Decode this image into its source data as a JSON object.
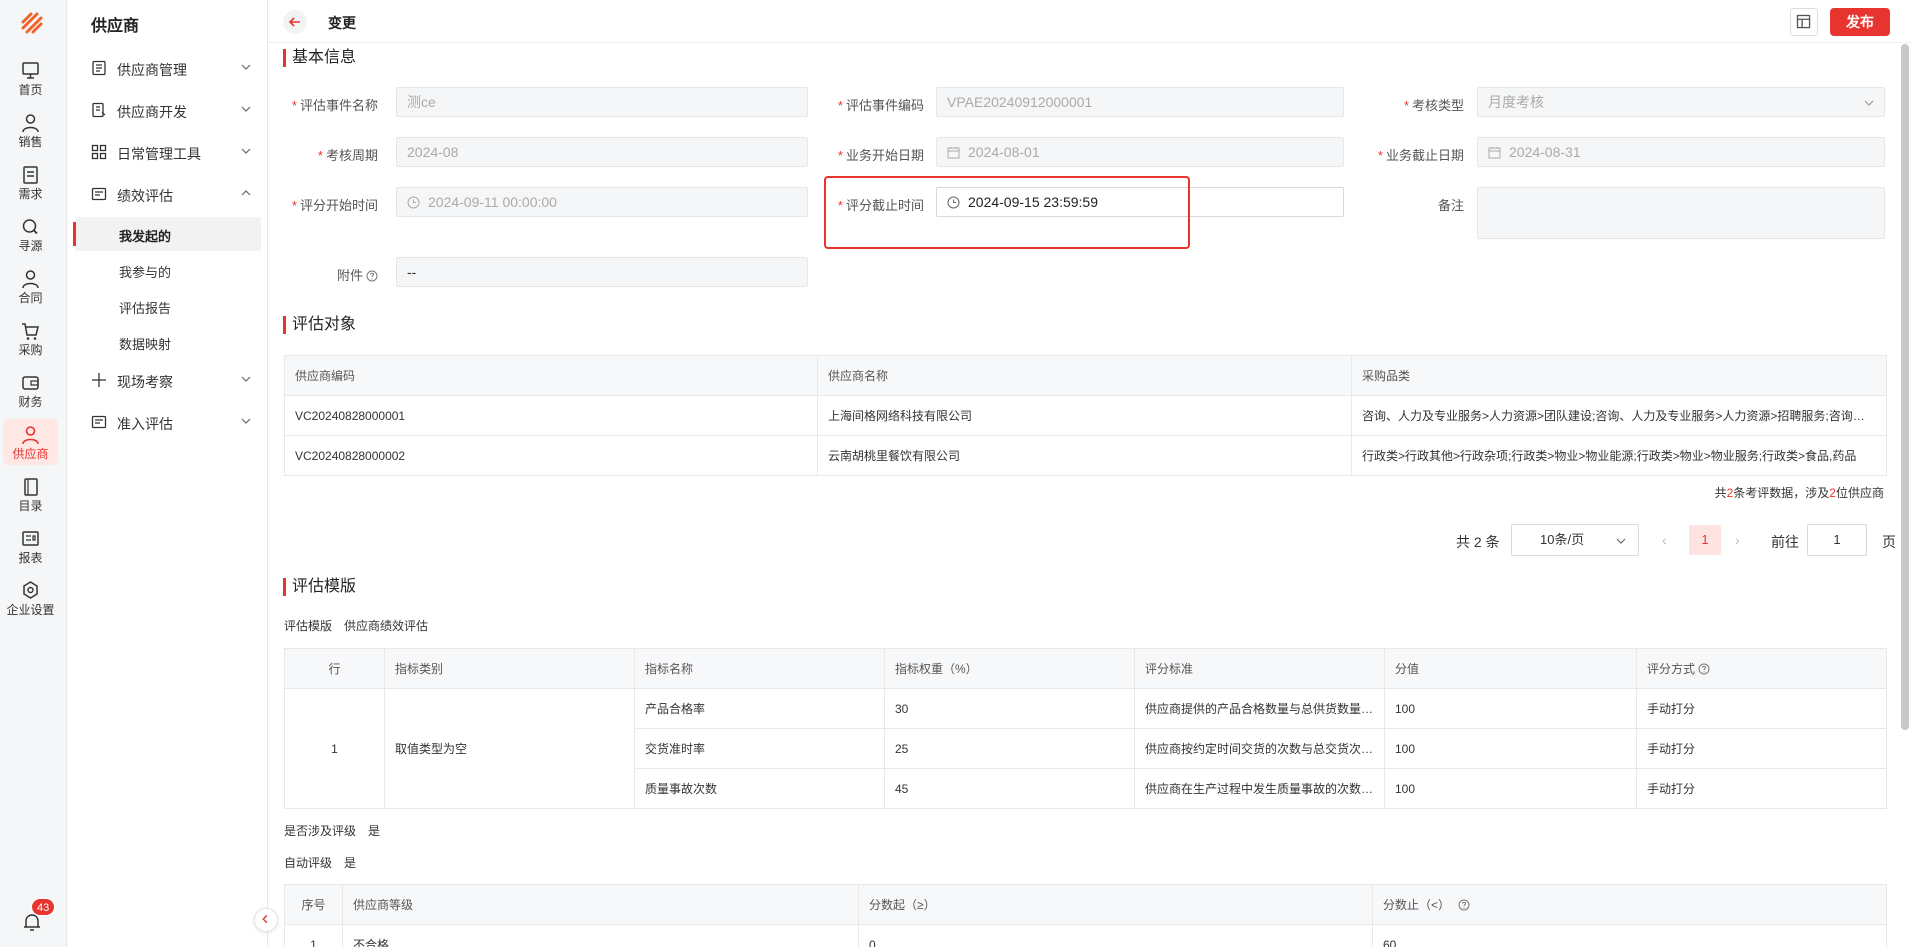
{
  "rail": {
    "items": [
      {
        "label": "首页",
        "icon": "monitor-icon"
      },
      {
        "label": "销售",
        "icon": "person-icon"
      },
      {
        "label": "需求",
        "icon": "clipboard-icon"
      },
      {
        "label": "寻源",
        "icon": "search-icon"
      },
      {
        "label": "合同",
        "icon": "person-icon"
      },
      {
        "label": "采购",
        "icon": "cart-icon"
      },
      {
        "label": "财务",
        "icon": "wallet-icon"
      },
      {
        "label": "供应商",
        "icon": "person-icon"
      },
      {
        "label": "目录",
        "icon": "book-icon"
      },
      {
        "label": "报表",
        "icon": "report-icon"
      },
      {
        "label": "企业设置",
        "icon": "hexagon-settings-icon"
      }
    ],
    "notification_count": "43"
  },
  "menu": {
    "title": "供应商",
    "items": [
      {
        "label": "供应商管理"
      },
      {
        "label": "供应商开发"
      },
      {
        "label": "日常管理工具"
      },
      {
        "label": "绩效评估"
      },
      {
        "label": "现场考察"
      },
      {
        "label": "准入评估"
      }
    ],
    "sub_items": [
      {
        "label": "我发起的"
      },
      {
        "label": "我参与的"
      },
      {
        "label": "评估报告"
      },
      {
        "label": "数据映射"
      }
    ]
  },
  "topbar": {
    "title": "变更",
    "publish_label": "发布"
  },
  "basic": {
    "section_title": "基本信息",
    "event_name_label": "评估事件名称",
    "event_name_value": "测ce",
    "event_code_label": "评估事件编码",
    "event_code_value": "VPAE20240912000001",
    "type_label": "考核类型",
    "type_value": "月度考核",
    "period_label": "考核周期",
    "period_value": "2024-08",
    "biz_start_label": "业务开始日期",
    "biz_start_value": "2024-08-01",
    "biz_end_label": "业务截止日期",
    "biz_end_value": "2024-08-31",
    "score_start_label": "评分开始时间",
    "score_start_value": "2024-09-11 00:00:00",
    "score_end_label": "评分截止时间",
    "score_end_value": "2024-09-15 23:59:59",
    "remark_label": "备注",
    "attach_label": "附件",
    "attach_value": "--",
    "required_mark": "*"
  },
  "objects": {
    "section_title": "评估对象",
    "headers": [
      "供应商编码",
      "供应商名称",
      "采购品类"
    ],
    "rows": [
      [
        "VC20240828000001",
        "上海间格网络科技有限公司",
        "咨询、人力及专业服务>人力资源>团队建设;咨询、人力及专业服务>人力资源>招聘服务;咨询、人力及专业服务"
      ],
      [
        "VC20240828000002",
        "云南胡桃里餐饮有限公司",
        "行政类>行政其他>行政杂项;行政类>物业>物业能源;行政类>物业>物业服务;行政类>食品,药品"
      ]
    ],
    "summary_pre": "共",
    "summary_count": "2",
    "summary_mid": "条考评数据，涉及",
    "summary_suppliers": "2",
    "summary_post": "位供应商"
  },
  "pager": {
    "total": "共 2 条",
    "page_size": "10条/页",
    "prev": "‹",
    "current": "1",
    "next": "›",
    "goto_label": "前往",
    "goto_value": "1",
    "page_suffix": "页"
  },
  "template": {
    "section_title": "评估模版",
    "template_label": "评估模版",
    "template_value": "供应商绩效评估",
    "headers": [
      "行",
      "指标类别",
      "指标名称",
      "指标权重（%）",
      "评分标准",
      "分值",
      "评分方式"
    ],
    "row_no": "1",
    "category": "取值类型为空",
    "rows": [
      {
        "name": "产品合格率",
        "weight": "30",
        "standard": "供应商提供的产品合格数量与总供货数量的比率",
        "score": "100",
        "method": "手动打分"
      },
      {
        "name": "交货准时率",
        "weight": "25",
        "standard": "供应商按约定时间交货的次数与总交货次数的比率",
        "score": "100",
        "method": "手动打分"
      },
      {
        "name": "质量事故次数",
        "weight": "45",
        "standard": "供应商在生产过程中发生质量事故的次数统计",
        "score": "100",
        "method": "手动打分"
      }
    ],
    "grading_label": "是否涉及评级",
    "grading_value": "是",
    "auto_label": "自动评级",
    "auto_value": "是"
  },
  "levels": {
    "headers": [
      "序号",
      "供应商等级",
      "分数起（≥）",
      "分数止（<）"
    ],
    "rows": [
      [
        "1",
        "不合格",
        "0",
        "60"
      ]
    ]
  }
}
